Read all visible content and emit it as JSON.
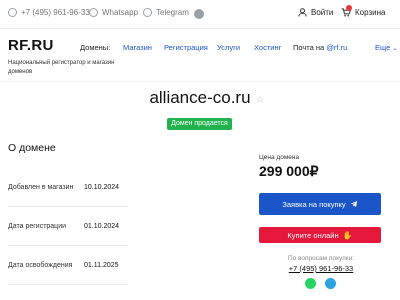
{
  "topbar": {
    "phone": "+7 (495) 961-96-33",
    "whatsapp": "Whatsapp",
    "telegram": "Telegram",
    "login": "Войти",
    "cart": "Корзина"
  },
  "header": {
    "logo": "RF.RU",
    "logo_sub": "Национальный регистратор и магазин доменов",
    "nav": {
      "domains": "Домены:",
      "shop": "Магазин",
      "registration": "Регистрация",
      "services": "Услуги",
      "hosting": "Хостинг",
      "mail_prefix": "Почта на ",
      "mail_link": "@rf.ru",
      "more": "Еще"
    }
  },
  "domain": {
    "name": "alliance-co.ru",
    "status": "Домен продается"
  },
  "about": {
    "title": "О домене",
    "rows": [
      {
        "label": "Добавлен в магазин",
        "value": "10.10.2024"
      },
      {
        "label": "Дата регистрации",
        "value": "01.10.2024"
      },
      {
        "label": "Дата освобождения",
        "value": "01.11.2025"
      }
    ]
  },
  "price_card": {
    "label": "Цена домена",
    "price": "299 000₽",
    "buy_request": "Заявка на покупку",
    "buy_online": "Купите онлайн",
    "questions": "По вопросам покупки:",
    "phone": "+7 (495) 961-96-33"
  },
  "colors": {
    "accent": "#1a56c9",
    "sale": "#21b24b",
    "buy_online": "#e5183c",
    "whatsapp": "#25d366",
    "telegram": "#2aa3e0"
  },
  "icons": [
    "phone-icon",
    "whatsapp-icon",
    "telegram-icon",
    "vk-icon",
    "user-icon",
    "cart-icon",
    "star-icon",
    "telegram-icon",
    "hand-icon",
    "whatsapp-icon",
    "telegram-icon"
  ]
}
